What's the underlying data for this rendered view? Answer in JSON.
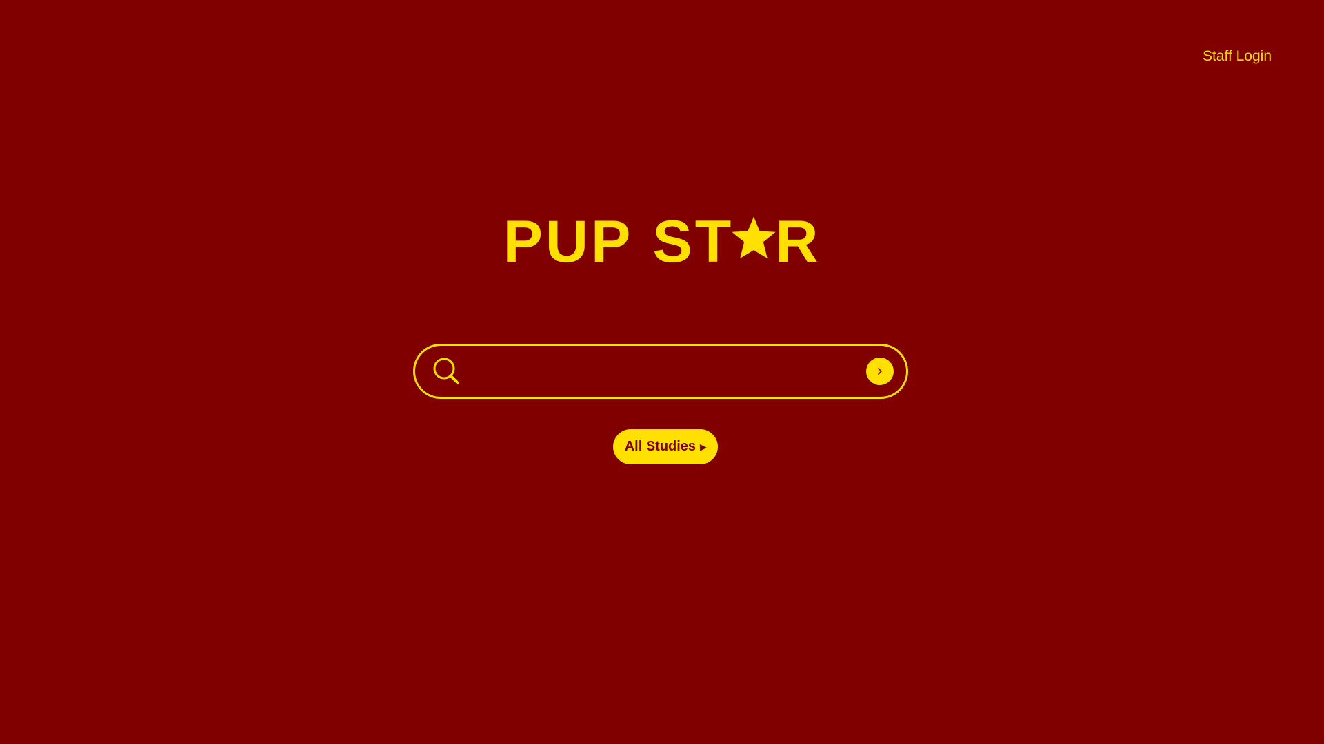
{
  "header": {
    "staff_login_label": "Staff Login"
  },
  "logo": {
    "part1": "PUP",
    "part2_before_star": "ST",
    "part2_after_star": "R"
  },
  "search": {
    "placeholder": "",
    "value": "",
    "icon": "search-icon",
    "submit_icon": "chevron-right-icon"
  },
  "actions": {
    "all_studies_label": "All Studies",
    "all_studies_icon": "triangle-right-icon"
  },
  "colors": {
    "background": "#800000",
    "accent": "#FFE000"
  }
}
